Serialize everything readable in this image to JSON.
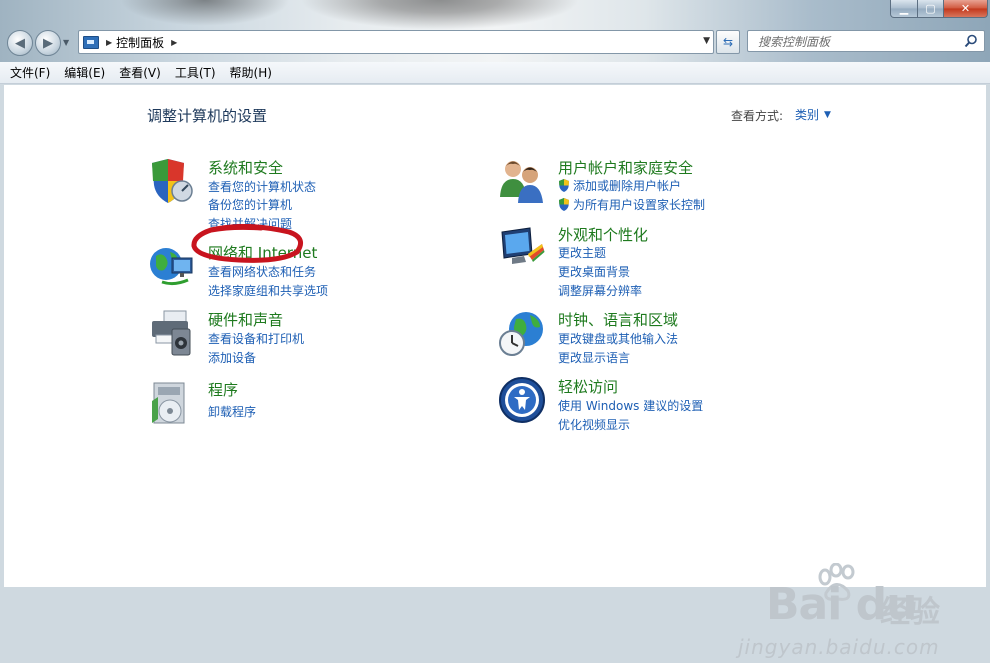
{
  "window": {
    "caption": {
      "minimize": "▁",
      "maximize": "▢",
      "close": "✕"
    },
    "address": {
      "path": "控制面板"
    },
    "search": {
      "placeholder": "搜索控制面板"
    }
  },
  "menu": [
    "文件(F)",
    "编辑(E)",
    "查看(V)",
    "工具(T)",
    "帮助(H)"
  ],
  "main": {
    "title": "调整计算机的设置",
    "view_by_label": "查看方式:",
    "view_by_value": "类别"
  },
  "categories": {
    "security": {
      "title": "系统和安全",
      "links": [
        "查看您的计算机状态",
        "备份您的计算机",
        "查找并解决问题"
      ]
    },
    "network": {
      "title": "网络和 Internet",
      "links": [
        "查看网络状态和任务",
        "选择家庭组和共享选项"
      ]
    },
    "hardware": {
      "title": "硬件和声音",
      "links": [
        "查看设备和打印机",
        "添加设备"
      ]
    },
    "programs": {
      "title": "程序",
      "links": [
        "卸载程序"
      ]
    },
    "users": {
      "title": "用户帐户和家庭安全",
      "links": [
        "添加或删除用户帐户",
        "为所有用户设置家长控制"
      ]
    },
    "appearance": {
      "title": "外观和个性化",
      "links": [
        "更改主题",
        "更改桌面背景",
        "调整屏幕分辨率"
      ]
    },
    "clock": {
      "title": "时钟、语言和区域",
      "links": [
        "更改键盘或其他输入法",
        "更改显示语言"
      ]
    },
    "ease": {
      "title": "轻松访问",
      "links": [
        "使用 Windows 建议的设置",
        "优化视频显示"
      ]
    }
  },
  "watermark": {
    "brand": "Bai du",
    "cn": "经验",
    "url": "jingyan.baidu.com"
  },
  "colors": {
    "category_title": "#1e7a1e",
    "link": "#1e5fb4",
    "page_title": "#1e395b",
    "annotation": "#c8141e"
  }
}
